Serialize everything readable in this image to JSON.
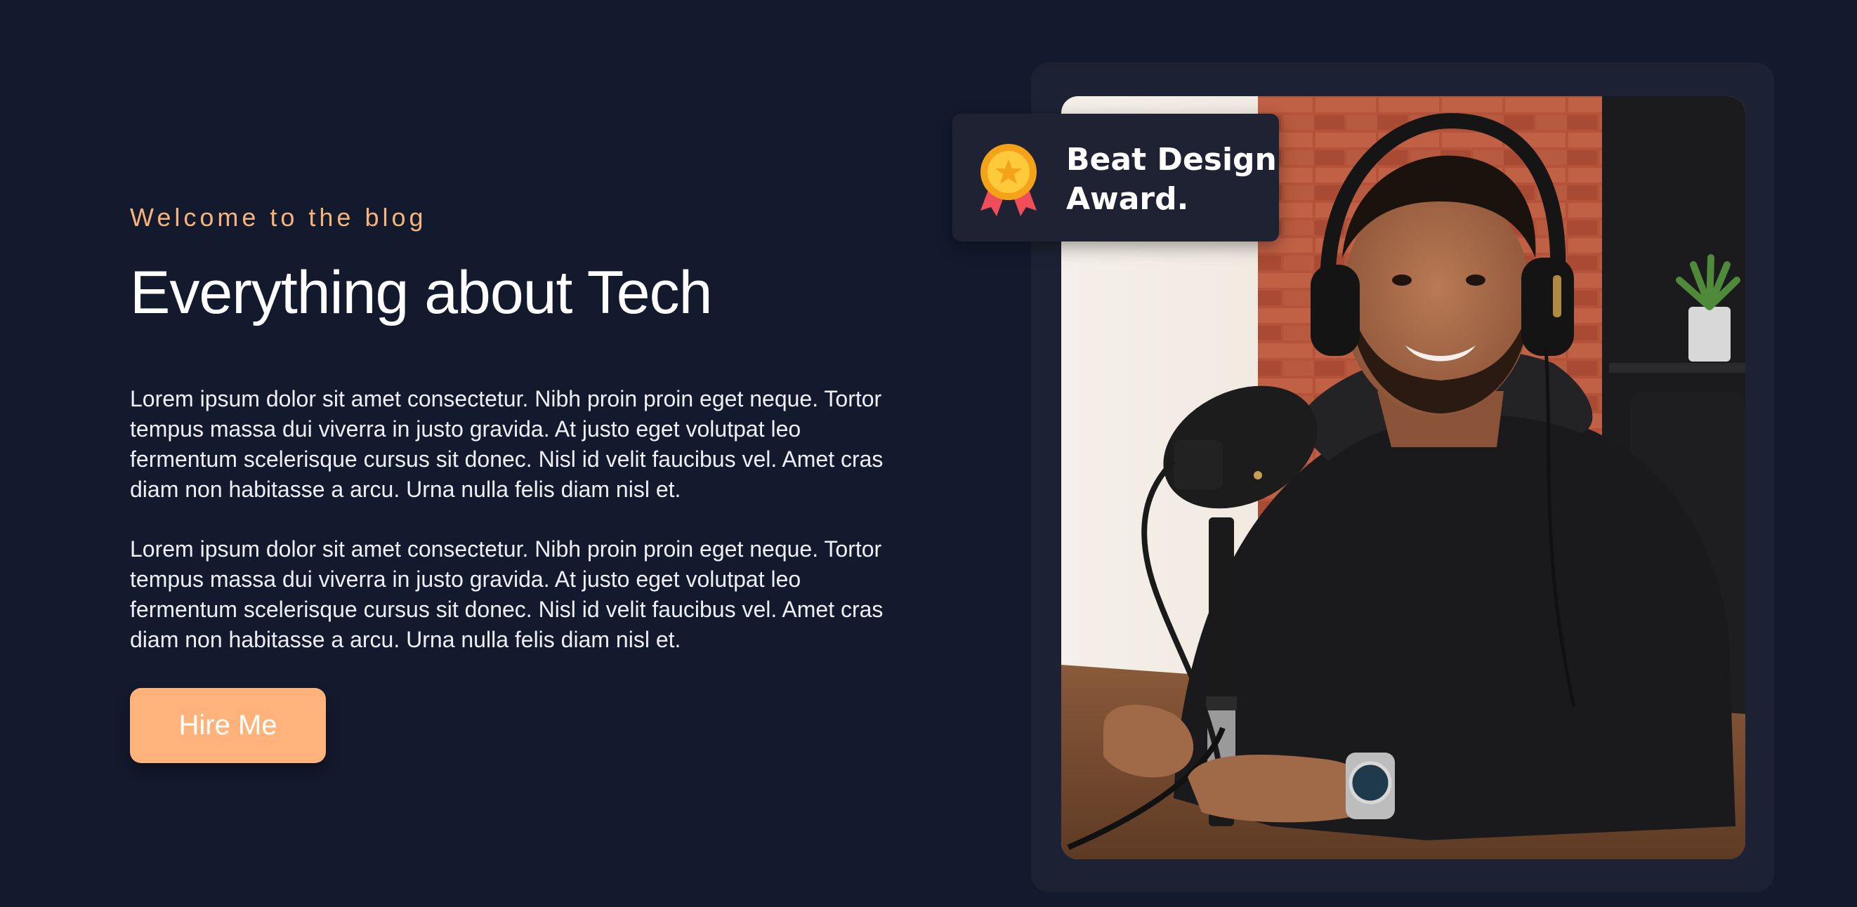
{
  "hero": {
    "eyebrow": "Welcome to the blog",
    "title": "Everything about Tech",
    "paragraphs": [
      "Lorem ipsum dolor sit amet consectetur. Nibh proin proin eget neque. Tortor tempus massa dui viverra in justo gravida. At justo eget volutpat leo fermentum scelerisque cursus sit donec. Nisl id velit faucibus vel. Amet cras diam non habitasse a arcu. Urna nulla felis diam nisl et.",
      "Lorem ipsum dolor sit amet consectetur. Nibh proin proin eget neque. Tortor tempus massa dui viverra in justo gravida. At justo eget volutpat leo fermentum scelerisque cursus sit donec. Nisl id velit faucibus vel. Amet cras diam non habitasse a arcu. Urna nulla felis diam nisl et."
    ],
    "cta_label": "Hire Me"
  },
  "award": {
    "line1": "Beat Design",
    "line2": "Award.",
    "icon": "award-medal-icon"
  },
  "colors": {
    "background": "#131a2e",
    "accent": "#ffb37a",
    "eyebrow": "#f7b47a",
    "card": "#1c2233"
  }
}
